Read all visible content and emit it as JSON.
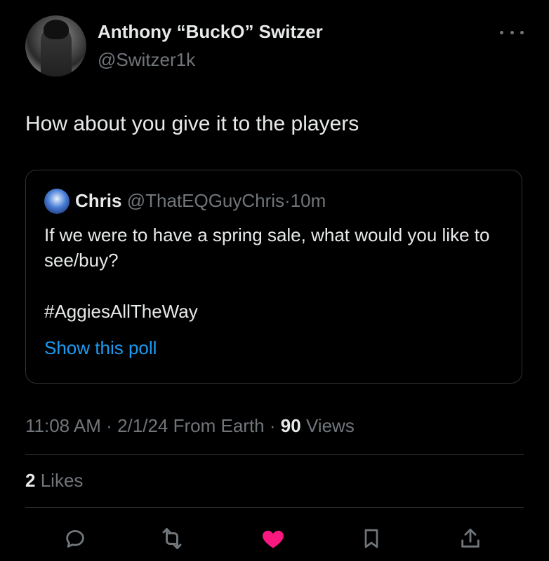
{
  "author": {
    "display_name": "Anthony “BuckO” Switzer",
    "handle": "@Switzer1k"
  },
  "tweet": {
    "text": "How about you give it to the players",
    "time": "11:08 AM",
    "date": "2/1/24",
    "location": "From Earth",
    "views_count": "90",
    "views_label": "Views",
    "likes_count": "2",
    "likes_label": "Likes"
  },
  "quoted": {
    "name": "Chris",
    "handle": "@ThatEQGuyChris",
    "time": "10m",
    "text": "If we were to have a spring sale, what would you like to see/buy?",
    "hashtag": "#AggiesAllTheWay",
    "poll_link": "Show this poll"
  },
  "icons": {
    "reply": "reply-icon",
    "retweet": "retweet-icon",
    "like": "heart-icon",
    "bookmark": "bookmark-icon",
    "share": "share-icon",
    "more": "more-icon"
  },
  "colors": {
    "background": "#000000",
    "text": "#e7e9ea",
    "secondary": "#71767b",
    "link": "#1d9bf0",
    "like": "#f91880",
    "border": "#2f3336"
  }
}
